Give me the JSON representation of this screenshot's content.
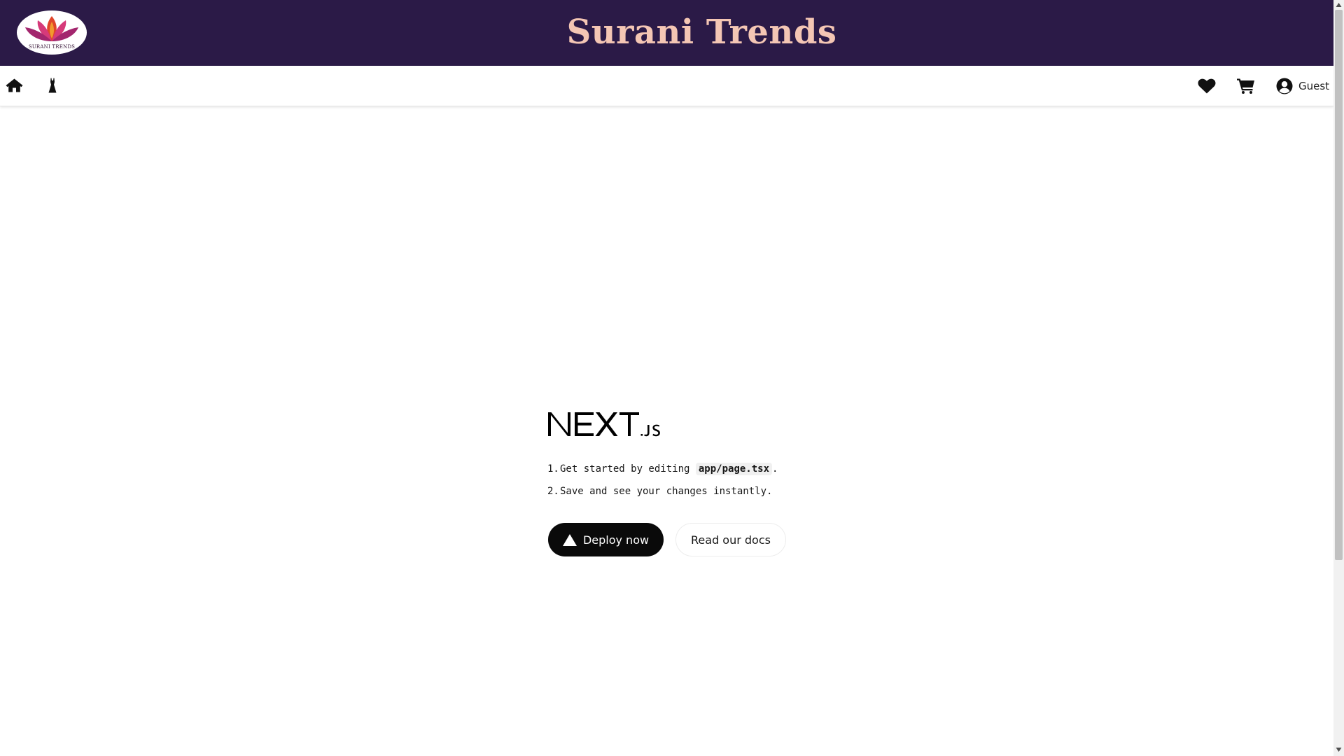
{
  "brand": {
    "title": "Surani Trends",
    "logo_text": "SURANI TRENDS",
    "bar_color": "#2b1a47",
    "title_color": "#f4c6b4"
  },
  "nav": {
    "left_icons": [
      "home-icon",
      "dress-icon"
    ],
    "right_icons": [
      "heart-icon",
      "cart-icon",
      "user-icon"
    ],
    "user_label": "Guest"
  },
  "main": {
    "logo": "NEXT.js",
    "steps": [
      {
        "number": "1.",
        "text_before": "Get started by editing",
        "code": "app/page.tsx",
        "text_after": "."
      },
      {
        "number": "2.",
        "text": "Save and see your changes instantly."
      }
    ],
    "deploy_label": "Deploy now",
    "docs_label": "Read our docs"
  }
}
